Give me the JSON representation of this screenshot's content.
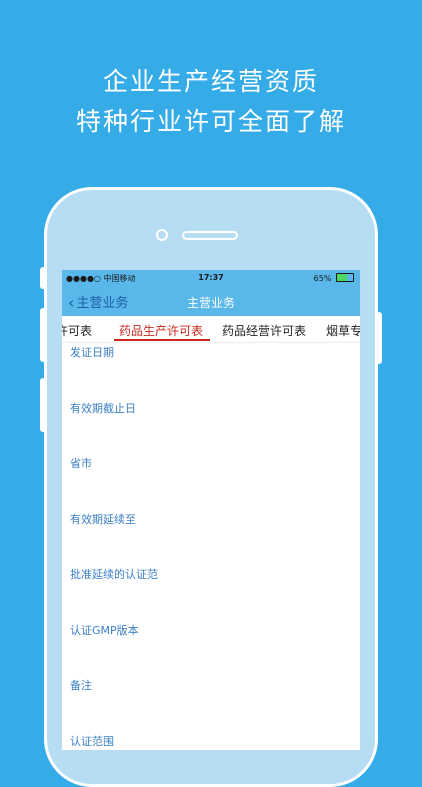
{
  "promo": {
    "line1": "企业生产经营资质",
    "line2": "特种行业许可全面了解"
  },
  "status_bar": {
    "carrier": "●●●●○ 中国移动",
    "time": "17:37",
    "battery": "65%",
    "battery_level": 0.65
  },
  "nav": {
    "back_label": "主营业务",
    "title": "主营业务"
  },
  "tabs": [
    "许可表",
    "药品生产许可表",
    "药品经营许可表",
    "烟草专"
  ],
  "fields": [
    "发证日期",
    "有效期截止日",
    "省市",
    "有效期延续至",
    "批准延续的认证范",
    "认证GMP版本",
    "备注",
    "认证范围"
  ]
}
